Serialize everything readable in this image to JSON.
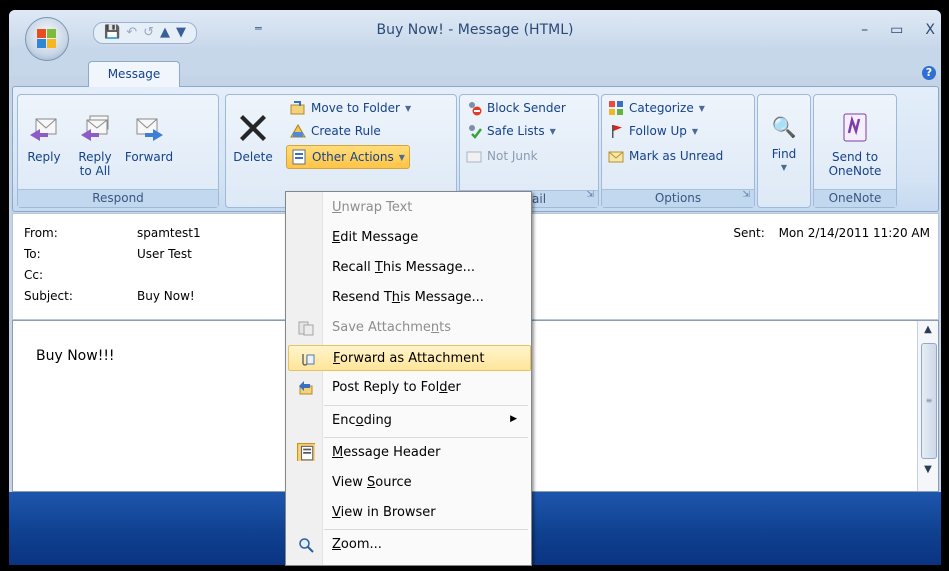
{
  "window": {
    "title": "Buy Now! - Message (HTML)",
    "minimize": "–",
    "maximize": "▭",
    "close": "X",
    "qat_more": "═"
  },
  "tabs": {
    "message": "Message"
  },
  "help": "?",
  "groups": {
    "respond": "Respond",
    "junk": "ail",
    "options": "Options",
    "onenote": "OneNote"
  },
  "buttons": {
    "reply": "Reply",
    "reply_all_1": "Reply",
    "reply_all_2": "to All",
    "forward": "Forward",
    "delete": "Delete",
    "move_to_folder": "Move to Folder",
    "create_rule": "Create Rule",
    "other_actions": "Other Actions",
    "block_sender": "Block Sender",
    "safe_lists": "Safe Lists",
    "not_junk": "Not Junk",
    "categorize": "Categorize",
    "follow_up": "Follow Up",
    "mark_unread": "Mark as Unread",
    "find": "Find",
    "send_onenote_1": "Send to",
    "send_onenote_2": "OneNote"
  },
  "header": {
    "from_label": "From:",
    "from_value": "spamtest1",
    "to_label": "To:",
    "to_value": "User Test",
    "cc_label": "Cc:",
    "subject_label": "Subject:",
    "subject_value": "Buy Now!",
    "sent_label": "Sent:",
    "sent_value": "Mon 2/14/2011 11:20 AM"
  },
  "body": {
    "text": "Buy Now!!!"
  },
  "menu": {
    "unwrap_text": [
      "",
      "U",
      "nwrap Text"
    ],
    "edit_message": [
      "",
      "E",
      "dit Message"
    ],
    "recall_message": [
      "Recall ",
      "T",
      "his Message..."
    ],
    "resend_message": [
      "Resend T",
      "h",
      "is Message..."
    ],
    "save_attachments": [
      "Save Attachme",
      "n",
      "ts"
    ],
    "forward_attachment": [
      "",
      "F",
      "orward as Attachment"
    ],
    "post_reply": [
      "Post Reply to Fol",
      "d",
      "er"
    ],
    "encoding": [
      "Enc",
      "o",
      "ding"
    ],
    "message_header": [
      "",
      "M",
      "essage Header"
    ],
    "view_source": [
      "View ",
      "S",
      "ource"
    ],
    "view_browser": [
      "",
      "V",
      "iew in Browser"
    ],
    "zoom": [
      "",
      "Z",
      "oom..."
    ]
  },
  "colors": {
    "ribbon_text": "#15428b",
    "menu_highlight": "#ffe59a",
    "status_blue": "#0e3f8e"
  }
}
